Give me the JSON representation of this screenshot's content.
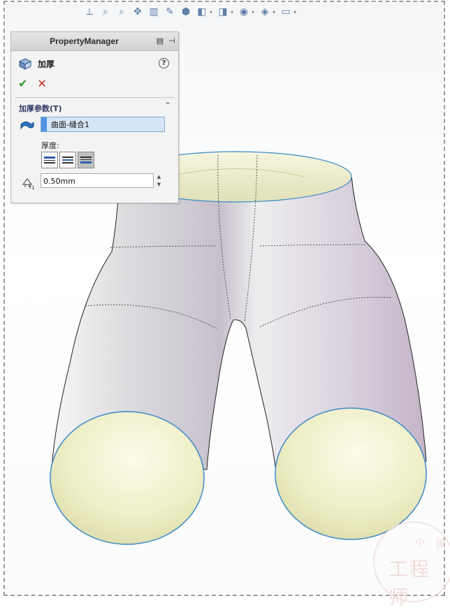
{
  "property_manager": {
    "title": "PropertyManager",
    "feature_name": "加厚",
    "help_label": "?",
    "ok_symbol": "✔",
    "cancel_symbol": "✕",
    "section_title": "加厚参数(T)",
    "collapse_symbol": "⌃",
    "selection_value": "曲面-缝合1",
    "thickness_label": "厚度:",
    "thickness_options": [
      "side1",
      "both-sides",
      "side2"
    ],
    "thickness_selected": "side2",
    "depth_value": "0.50mm",
    "spinner_up": "▲",
    "spinner_down": "▼"
  },
  "toolbar": {
    "icons": [
      "view-orientation-icon",
      "zoom-to-fit-icon",
      "zoom-area-icon",
      "pan-icon",
      "section-view-icon",
      "dynamic-annotation-icon",
      "display-style-icon",
      "hide-show-icon",
      "edit-appearance-icon",
      "apply-scene-icon",
      "view-settings-icon",
      "monitor-icon"
    ]
  },
  "watermark": {
    "small_left": "小",
    "small_right": "國",
    "big": "工程师"
  },
  "colors": {
    "accent": "#4f95e2",
    "ok": "#2c9a2c",
    "cancel": "#c2271f",
    "selection_bg": "#d5e5f6"
  }
}
